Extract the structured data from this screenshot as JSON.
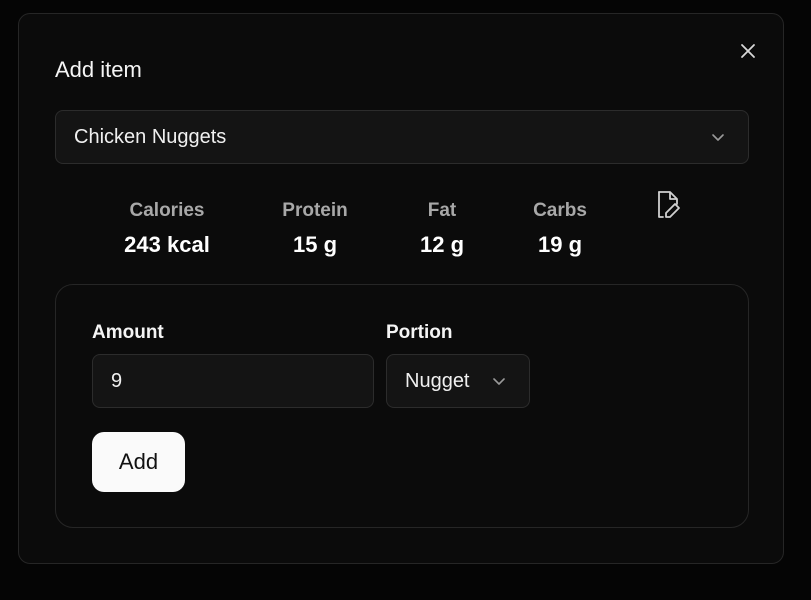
{
  "dialog": {
    "title": "Add item",
    "close_icon": "close-icon"
  },
  "food_select": {
    "value": "Chicken Nuggets",
    "icon": "chevron-down-icon"
  },
  "nutrition": {
    "calories": {
      "label": "Calories",
      "value": "243 kcal"
    },
    "protein": {
      "label": "Protein",
      "value": "15 g"
    },
    "fat": {
      "label": "Fat",
      "value": "12 g"
    },
    "carbs": {
      "label": "Carbs",
      "value": "19 g"
    },
    "edit_icon": "edit-file-icon"
  },
  "form": {
    "amount_label": "Amount",
    "amount_value": "9",
    "portion_label": "Portion",
    "portion_value": "Nugget",
    "add_label": "Add"
  },
  "colors": {
    "background": "#050505",
    "dialog": "#0b0b0b",
    "input": "#141414",
    "border": "#2c2c2c",
    "muted_text": "#a8a8a8",
    "primary_button": "#fafafa"
  }
}
